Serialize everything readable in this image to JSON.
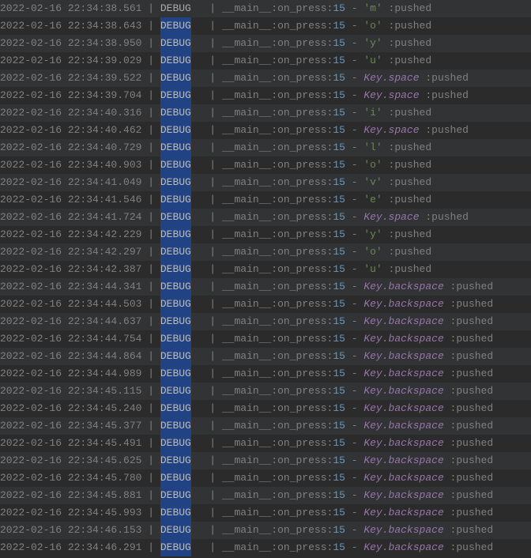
{
  "module_text": "__main__:on_press:",
  "line_number": "15",
  "level_text": "DEBUG",
  "level_padding": "   ",
  "pushed_text": " :pushed",
  "sep_text": " | ",
  "pipe_text": "| ",
  "dash_text": " - ",
  "entries": [
    {
      "timestamp": "2022-02-16 22:34:38.561",
      "key": "'m'",
      "key_type": "char",
      "highlighted": false
    },
    {
      "timestamp": "2022-02-16 22:34:38.643",
      "key": "'o'",
      "key_type": "char",
      "highlighted": true
    },
    {
      "timestamp": "2022-02-16 22:34:38.950",
      "key": "'y'",
      "key_type": "char",
      "highlighted": true
    },
    {
      "timestamp": "2022-02-16 22:34:39.029",
      "key": "'u'",
      "key_type": "char",
      "highlighted": true
    },
    {
      "timestamp": "2022-02-16 22:34:39.522",
      "key": "Key.space",
      "key_type": "special",
      "highlighted": true
    },
    {
      "timestamp": "2022-02-16 22:34:39.704",
      "key": "Key.space",
      "key_type": "special",
      "highlighted": true
    },
    {
      "timestamp": "2022-02-16 22:34:40.316",
      "key": "'i'",
      "key_type": "char",
      "highlighted": true
    },
    {
      "timestamp": "2022-02-16 22:34:40.462",
      "key": "Key.space",
      "key_type": "special",
      "highlighted": true
    },
    {
      "timestamp": "2022-02-16 22:34:40.729",
      "key": "'l'",
      "key_type": "char",
      "highlighted": true
    },
    {
      "timestamp": "2022-02-16 22:34:40.903",
      "key": "'o'",
      "key_type": "char",
      "highlighted": true
    },
    {
      "timestamp": "2022-02-16 22:34:41.049",
      "key": "'v'",
      "key_type": "char",
      "highlighted": true
    },
    {
      "timestamp": "2022-02-16 22:34:41.546",
      "key": "'e'",
      "key_type": "char",
      "highlighted": true
    },
    {
      "timestamp": "2022-02-16 22:34:41.724",
      "key": "Key.space",
      "key_type": "special",
      "highlighted": true
    },
    {
      "timestamp": "2022-02-16 22:34:42.229",
      "key": "'y'",
      "key_type": "char",
      "highlighted": true
    },
    {
      "timestamp": "2022-02-16 22:34:42.297",
      "key": "'o'",
      "key_type": "char",
      "highlighted": true
    },
    {
      "timestamp": "2022-02-16 22:34:42.387",
      "key": "'u'",
      "key_type": "char",
      "highlighted": true
    },
    {
      "timestamp": "2022-02-16 22:34:44.341",
      "key": "Key.backspace",
      "key_type": "special",
      "highlighted": true
    },
    {
      "timestamp": "2022-02-16 22:34:44.503",
      "key": "Key.backspace",
      "key_type": "special",
      "highlighted": true
    },
    {
      "timestamp": "2022-02-16 22:34:44.637",
      "key": "Key.backspace",
      "key_type": "special",
      "highlighted": true
    },
    {
      "timestamp": "2022-02-16 22:34:44.754",
      "key": "Key.backspace",
      "key_type": "special",
      "highlighted": true
    },
    {
      "timestamp": "2022-02-16 22:34:44.864",
      "key": "Key.backspace",
      "key_type": "special",
      "highlighted": true
    },
    {
      "timestamp": "2022-02-16 22:34:44.989",
      "key": "Key.backspace",
      "key_type": "special",
      "highlighted": true
    },
    {
      "timestamp": "2022-02-16 22:34:45.115",
      "key": "Key.backspace",
      "key_type": "special",
      "highlighted": true
    },
    {
      "timestamp": "2022-02-16 22:34:45.240",
      "key": "Key.backspace",
      "key_type": "special",
      "highlighted": true
    },
    {
      "timestamp": "2022-02-16 22:34:45.377",
      "key": "Key.backspace",
      "key_type": "special",
      "highlighted": true
    },
    {
      "timestamp": "2022-02-16 22:34:45.491",
      "key": "Key.backspace",
      "key_type": "special",
      "highlighted": true
    },
    {
      "timestamp": "2022-02-16 22:34:45.625",
      "key": "Key.backspace",
      "key_type": "special",
      "highlighted": true
    },
    {
      "timestamp": "2022-02-16 22:34:45.780",
      "key": "Key.backspace",
      "key_type": "special",
      "highlighted": true
    },
    {
      "timestamp": "2022-02-16 22:34:45.881",
      "key": "Key.backspace",
      "key_type": "special",
      "highlighted": true
    },
    {
      "timestamp": "2022-02-16 22:34:45.993",
      "key": "Key.backspace",
      "key_type": "special",
      "highlighted": true
    },
    {
      "timestamp": "2022-02-16 22:34:46.153",
      "key": "Key.backspace",
      "key_type": "special",
      "highlighted": true
    },
    {
      "timestamp": "2022-02-16 22:34:46.291",
      "key": "Key.backspace",
      "key_type": "special",
      "highlighted": true
    }
  ]
}
